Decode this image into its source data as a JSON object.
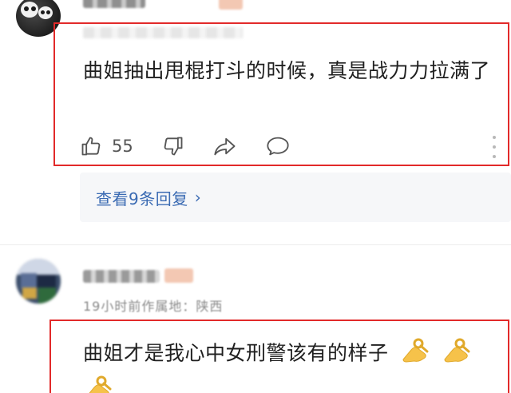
{
  "comments": [
    {
      "text": "曲姐抽出甩棍打斗的时候，真是战力力拉满了",
      "actions": {
        "like_count": "55",
        "like_icon": "thumbs-up-icon",
        "dislike_icon": "thumbs-down-icon",
        "share_icon": "share-icon",
        "reply_icon": "comment-icon",
        "more_icon": "more-vertical-icon"
      },
      "replies_label": "查看9条回复",
      "replies_chevron": "›"
    },
    {
      "meta": "19小时前作属地：陕西",
      "text": "曲姐才是我心中女刑警该有的样子",
      "emoji": "ok-hand-icon"
    }
  ],
  "colors": {
    "highlight": "#e22a2a",
    "link": "#3b6bb3",
    "text": "#1f1f1f",
    "icon": "#555555"
  }
}
